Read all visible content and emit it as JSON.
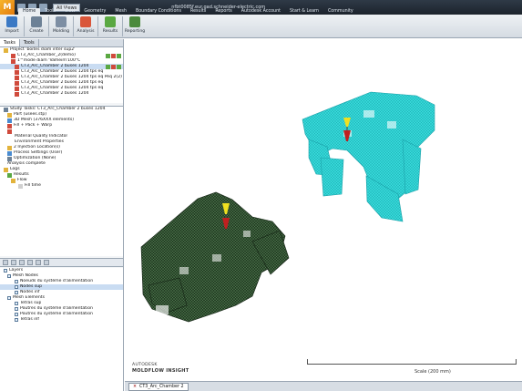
{
  "app": {
    "logo": "M",
    "view_select": "All Views",
    "window_title": "nfbt0085f.eur.gad.schneider-electric.com"
  },
  "ribbon_tabs": [
    "Home",
    "Tools",
    "View",
    "Geometry",
    "Mesh",
    "Boundary Conditions",
    "Results",
    "Reports",
    "Autodesk Account",
    "Start & Learn",
    "Community"
  ],
  "ribbon_buttons": [
    {
      "label": "Import",
      "color": "#3b79c4"
    },
    {
      "label": "Create",
      "color": "#6d8196"
    },
    {
      "label": "Molding",
      "color": "#7d8ea3"
    },
    {
      "label": "Analysis",
      "color": "#d9563a"
    },
    {
      "label": "Results",
      "color": "#5aa842"
    },
    {
      "label": "Reporting",
      "color": "#4b8a3c"
    }
  ],
  "panel_tabs": [
    "Tasks",
    "Tools"
  ],
  "task_tree": [
    {
      "text": "Project 'boites diam inter sup2'",
      "color": "#e2b33c",
      "indent": 1
    },
    {
      "text": "CT3_Arc_Chamber_2(demo)",
      "color": "#d04a3c",
      "indent": 3,
      "badges": true
    },
    {
      "text": "1^mode diam 'Valheim'100°C",
      "color": "#d04a3c",
      "indent": 3
    },
    {
      "text": "CT3_Arc_Chamber 2 buses 1204",
      "color": "#d04a3c",
      "indent": 4,
      "badges": true,
      "selected": true
    },
    {
      "text": "CT3_Arc_Chamber 2 buses 1204 tps eq",
      "color": "#d04a3c",
      "indent": 4
    },
    {
      "text": "CT3_Arc_Chamber 2 buses 1204 tps eq Peq 2(2)",
      "color": "#d04a3c",
      "indent": 4
    },
    {
      "text": "CT3_Arc_Chamber 2 buses 1204 tps eq",
      "color": "#d04a3c",
      "indent": 4
    },
    {
      "text": "CT3_Arc_Chamber 2 buses 1204 tps eq",
      "color": "#d04a3c",
      "indent": 4
    },
    {
      "text": "CT3_Arc_Chamber 2 buses 1204",
      "color": "#d04a3c",
      "indent": 4
    }
  ],
  "study_tree": [
    {
      "text": "Study Tasks: CT3_Arc_Chamber 2 buses 1204",
      "color": "#6d8196",
      "indent": 1
    },
    {
      "text": "Part (usees.stp)",
      "color": "#e2b33c",
      "indent": 2
    },
    {
      "text": "3D Mesh (376XXX elements)",
      "color": "#4a8bd0",
      "indent": 2
    },
    {
      "text": "Fill + Pack + Warp",
      "color": "#d04a3c",
      "indent": 2
    },
    {
      "text": "",
      "color": "#d04a3c",
      "indent": 2
    },
    {
      "text": "Material Quality Indicator",
      "color": "",
      "indent": 4
    },
    {
      "text": "Environment Properties",
      "color": "",
      "indent": 4
    },
    {
      "text": "2 Injection Location(s)",
      "color": "#e2b33c",
      "indent": 2
    },
    {
      "text": "Process Settings (User)",
      "color": "#4a8bd0",
      "indent": 2
    },
    {
      "text": "Optimization (None)",
      "color": "#6d8196",
      "indent": 2
    },
    {
      "text": "Analysis complete",
      "color": "",
      "indent": 2
    },
    {
      "text": "Logs",
      "color": "#e2b33c",
      "indent": 1
    },
    {
      "text": "Results",
      "color": "#5aa842",
      "indent": 2
    },
    {
      "text": "Flow",
      "color": "#e2b33c",
      "indent": 3
    },
    {
      "text": "Fill time",
      "color": "#d0d0d0",
      "indent": 5
    }
  ],
  "layers": [
    {
      "text": "Layers",
      "indent": 1
    },
    {
      "text": "Mesh Nodes",
      "indent": 2
    },
    {
      "text": "Noeuds du système d'alimentation",
      "indent": 4
    },
    {
      "text": "Nodes sup",
      "indent": 4,
      "selected": true
    },
    {
      "text": "Nodes inf",
      "indent": 4
    },
    {
      "text": "Mesh Elements",
      "indent": 2
    },
    {
      "text": "Tetras sup",
      "indent": 4
    },
    {
      "text": "Poutres du système d'alimentation",
      "indent": 4
    },
    {
      "text": "Poutres du système d'alimentation",
      "indent": 4
    },
    {
      "text": "Tetras inf",
      "indent": 4
    }
  ],
  "viewport": {
    "logo_line1": "AUTODESK",
    "logo_line2": "MOLDFLOW INSIGHT",
    "scale_label": "Scale (200 mm)"
  },
  "doc_tab": "CT3_Arc_Chamber 2",
  "colors": {
    "mesh_top": "#33d6d6",
    "mesh_bottom": "#1f3a1f",
    "gate_yellow": "#f0e020",
    "gate_red": "#c02020"
  }
}
